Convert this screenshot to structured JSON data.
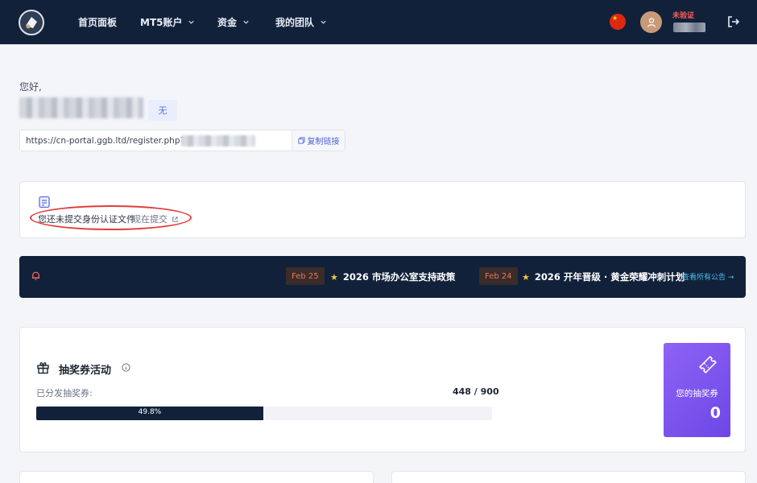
{
  "nav": {
    "items": [
      {
        "label": "首页面板",
        "has_dropdown": false
      },
      {
        "label": "MT5账户",
        "has_dropdown": true
      },
      {
        "label": "资金",
        "has_dropdown": true
      },
      {
        "label": "我的团队",
        "has_dropdown": true
      }
    ],
    "verification_status": "未验证",
    "icons": {
      "logo": "logo-icon",
      "flag": "china-flag-icon",
      "avatar": "user-avatar-icon",
      "logout": "logout-icon"
    }
  },
  "profile": {
    "greeting": "您好,",
    "level_badge": "无",
    "referral_link": "https://cn-portal.ggb.ltd/register.php?ref=",
    "copy_button_label": "复制链接"
  },
  "document_notice": {
    "text": "您还未提交身份认证文件",
    "link_label": "现在提交"
  },
  "announcements": {
    "items": [
      {
        "date": "Feb 25",
        "title": "2026 市场办公室支持政策"
      },
      {
        "date": "Feb 24",
        "title": "2026 开年晋级 · 黄金荣耀冲刺计划"
      }
    ],
    "view_all_label": "查看所有公告 →"
  },
  "lottery": {
    "title": "抽奖券活动",
    "distributed_label": "已分发抽奖券:",
    "distributed_count": "448 / 900",
    "progress_percent": 49.8,
    "progress_label": "49.8%",
    "your_tickets_label": "您的抽奖券",
    "your_tickets_value": "0"
  },
  "colors": {
    "nav_bg": "#12213a",
    "accent_purple": "#7c55ee",
    "link_blue": "#4e63d6",
    "warning_red": "#e23b3b",
    "date_chip": "#e07a5f",
    "star_gold": "#f4c542",
    "view_all": "#49c0ec"
  }
}
